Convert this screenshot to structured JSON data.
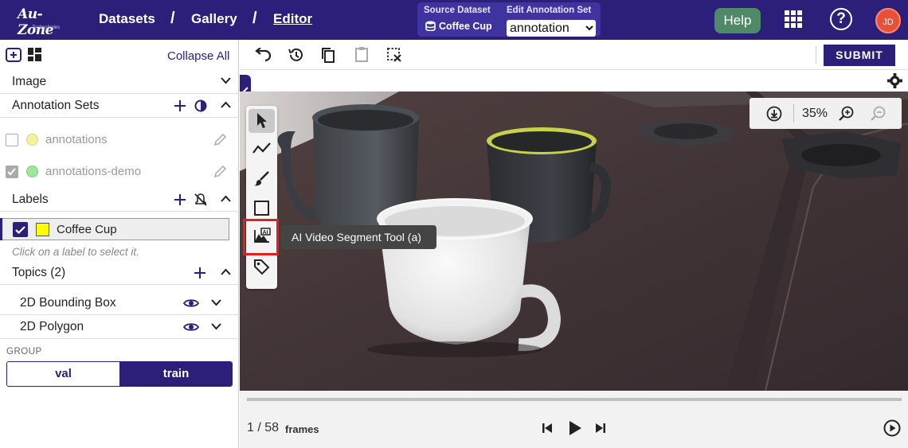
{
  "header": {
    "logo_text": "Au-Zone",
    "logo_sub": "Technologies",
    "breadcrumbs": [
      "Datasets",
      "Gallery",
      "Editor"
    ],
    "separator": "/",
    "source_dataset_label": "Source Dataset",
    "source_dataset_value": "Coffee Cup",
    "edit_annotation_label": "Edit Annotation Set",
    "edit_annotation_value": "annotation",
    "help_label": "Help",
    "avatar_initials": "JD"
  },
  "sidebar": {
    "collapse_all": "Collapse All",
    "image_section": "Image",
    "annotation_sets_section": "Annotation Sets",
    "annotation_sets": [
      {
        "name": "annotations",
        "checked": false,
        "color": "#f4f29a"
      },
      {
        "name": "annotations-demo",
        "checked": true,
        "color": "#9be89b"
      }
    ],
    "labels_section": "Labels",
    "labels": [
      {
        "name": "Coffee Cup",
        "color": "#ffff00",
        "checked": true
      }
    ],
    "label_hint": "Click on a label to select it.",
    "topics_section": "Topics (2)",
    "topics": [
      "2D Bounding Box",
      "2D Polygon"
    ],
    "group_label": "GROUP",
    "group_options": [
      "val",
      "train"
    ],
    "group_selected": "train"
  },
  "toolbar": {
    "submit_label": "SUBMIT"
  },
  "viewer": {
    "zoom_level": "35%",
    "tooltip": "AI Video Segment Tool (a)",
    "frame_current": "1 / 58",
    "frame_unit": "frames"
  },
  "colors": {
    "brand": "#2b1f7a",
    "help_button": "#4e8a68",
    "avatar": "#e8503a",
    "highlight_box": "#e0201e"
  }
}
